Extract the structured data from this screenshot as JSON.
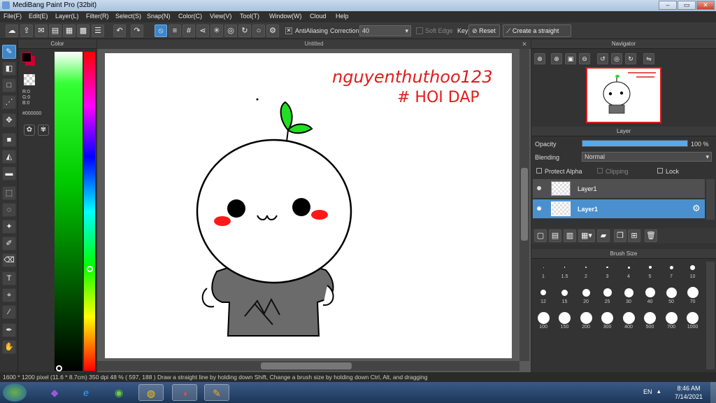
{
  "window": {
    "title": "MediBang Paint Pro (32bit)"
  },
  "menu": [
    "File(F)",
    "Edit(E)",
    "Layer(L)",
    "Filter(R)",
    "Select(S)",
    "Snap(N)",
    "Color(C)",
    "View(V)",
    "Tool(T)",
    "Window(W)",
    "Cloud",
    "Help"
  ],
  "toolbar": {
    "antialiasing_label": "AntiAliasing",
    "correction_label": "Correction",
    "correction_value": "40",
    "soft_edge_label": "Soft Edge",
    "key_label": "Key",
    "reset_label": "Reset",
    "straight_line_label": "Create a straight line"
  },
  "color_panel": {
    "title": "Color",
    "r": "R:0",
    "g": "G:0",
    "b": "B:0",
    "hex": "#000000"
  },
  "canvas": {
    "title": "Untitled",
    "handwriting_line1": "nguyenthuthoo123",
    "handwriting_line2": "# HOI DAP"
  },
  "navigator": {
    "title": "Navigator"
  },
  "layer_panel": {
    "title": "Layer",
    "opacity_label": "Opacity",
    "opacity_value": "100 %",
    "opacity_fraction": 1.0,
    "blending_label": "Blending",
    "blending_value": "Normal",
    "protect_alpha_label": "Protect Alpha",
    "clipping_label": "Clipping",
    "lock_label": "Lock",
    "layers": [
      {
        "name": "Layer1",
        "selected": false
      },
      {
        "name": "Layer1",
        "selected": true
      }
    ]
  },
  "brush_size_panel": {
    "title": "Brush Size",
    "sizes": [
      "1",
      "1.5",
      "2",
      "3",
      "4",
      "5",
      "7",
      "10",
      "12",
      "15",
      "20",
      "25",
      "30",
      "40",
      "50",
      "70",
      "100",
      "150",
      "200",
      "300",
      "400",
      "500",
      "700",
      "1000"
    ]
  },
  "statusbar": {
    "text": "1600 * 1200 pixel   (11.6 * 8.7cm)   350 dpi   48 %   ( 597, 188 )   Draw a straight line by holding down Shift, Change a brush size by holding down Ctrl, Alt, and dragging"
  },
  "taskbar": {
    "lang": "EN",
    "time": "8:46 AM",
    "date": "7/14/2021"
  },
  "colors": {
    "accent": "#3e86c8",
    "selected_layer": "#4a90cf",
    "foreground": "#000000",
    "background_swatch": "#cc0033"
  }
}
